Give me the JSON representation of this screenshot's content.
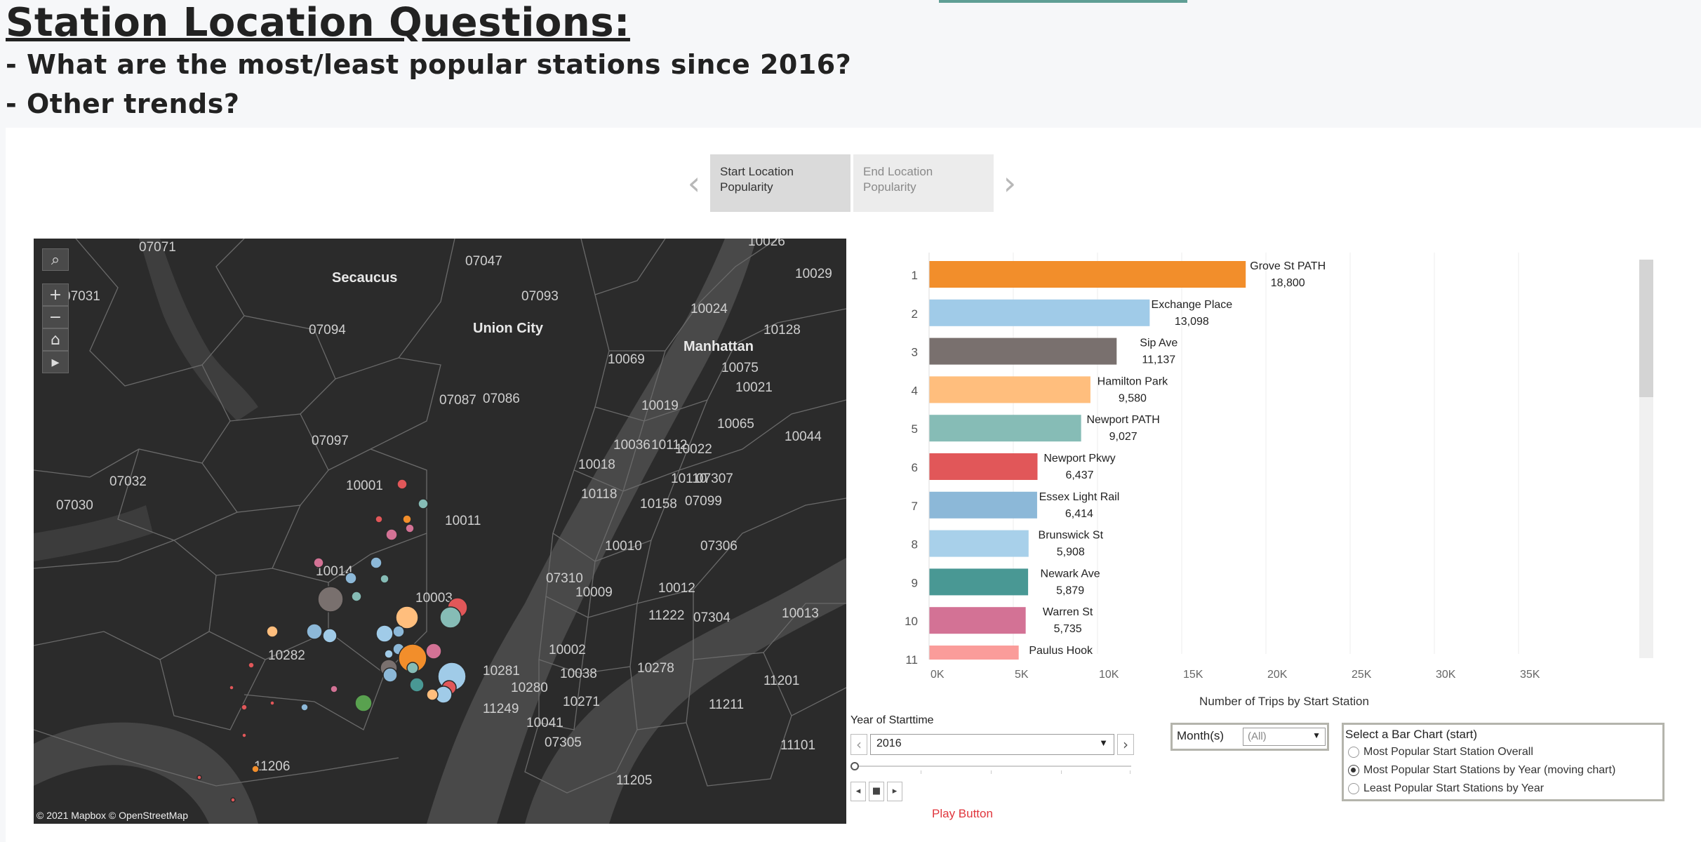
{
  "header": {
    "title": "Station Location Questions:",
    "q1": "- What are the most/least popular stations since 2016?",
    "q2": "- Other trends?"
  },
  "tabs": {
    "start": "Start Location Popularity",
    "end": "End Location Popularity"
  },
  "map": {
    "credit": "© 2021 Mapbox © OpenStreetMap",
    "places": [
      "Secaucus",
      "Union City",
      "Manhattan"
    ],
    "zips": [
      "07071",
      "07047",
      "07093",
      "10026",
      "10029",
      "07031",
      "07094",
      "10024",
      "10128",
      "10069",
      "10075",
      "10021",
      "07087",
      "07086",
      "10019",
      "10065",
      "10044",
      "07097",
      "10036",
      "10112",
      "10022",
      "10018",
      "10110",
      "07307",
      "07032",
      "10001",
      "10118",
      "10158",
      "07099",
      "07030",
      "10011",
      "10010",
      "07306",
      "10014",
      "07310",
      "10003",
      "10012",
      "10009",
      "11222",
      "10013",
      "07304",
      "10002",
      "10282",
      "10278",
      "10281",
      "10038",
      "10280",
      "10271",
      "11249",
      "10041",
      "11211",
      "07305",
      "11201",
      "11206",
      "11205",
      "11101"
    ],
    "colors": {
      "orange": "#f28e2b",
      "lightblue": "#a0cbe8",
      "gray": "#79706e",
      "peach": "#ffbe7d",
      "teal": "#86bcb6",
      "red": "#e15759",
      "blue": "#8cb8d8",
      "darkteal": "#499894",
      "pink": "#d37295",
      "salmon": "#fa9c9a"
    }
  },
  "chart_data": {
    "type": "bar",
    "orientation": "horizontal",
    "ranks": [
      "1",
      "2",
      "3",
      "4",
      "5",
      "6",
      "7",
      "8",
      "9",
      "10",
      "11"
    ],
    "categories": [
      "Grove St PATH",
      "Exchange Place",
      "Sip Ave",
      "Hamilton Park",
      "Newport PATH",
      "Newport Pkwy",
      "Essex Light Rail",
      "Brunswick St",
      "Newark Ave",
      "Warren St",
      "Paulus Hook"
    ],
    "values": [
      18800,
      13098,
      11137,
      9580,
      9027,
      6437,
      6414,
      5908,
      5879,
      5735,
      5320
    ],
    "value_labels": [
      "18,800",
      "13,098",
      "11,137",
      "9,580",
      "9,027",
      "6,437",
      "6,414",
      "5,908",
      "5,879",
      "5,735",
      ""
    ],
    "bar_colors": [
      "#f28e2b",
      "#a0cbe8",
      "#79706e",
      "#ffbe7d",
      "#86bcb6",
      "#e15759",
      "#8cb8d8",
      "#a8d0ea",
      "#499894",
      "#d37295",
      "#fa9c9a"
    ],
    "xlabel": "Number of Trips by Start Station",
    "xlim": [
      0,
      39000
    ],
    "xticks": [
      0,
      5000,
      10000,
      15000,
      20000,
      25000,
      30000,
      35000
    ],
    "xtick_labels": [
      "0K",
      "5K",
      "10K",
      "15K",
      "20K",
      "25K",
      "30K",
      "35K"
    ],
    "grid": true
  },
  "filters": {
    "year_label": "Year of Starttime",
    "year_value": "2016",
    "play_label": "Play Button",
    "month_label": "Month(s)",
    "month_value": "(All)",
    "barsel_title": "Select a Bar Chart (start)",
    "options": [
      {
        "label": "Most Popular Start Station Overall",
        "selected": false
      },
      {
        "label": "Most Popular Start Stations by Year (moving chart)",
        "selected": true
      },
      {
        "label": "Least Popular Start Stations by Year",
        "selected": false
      }
    ]
  }
}
